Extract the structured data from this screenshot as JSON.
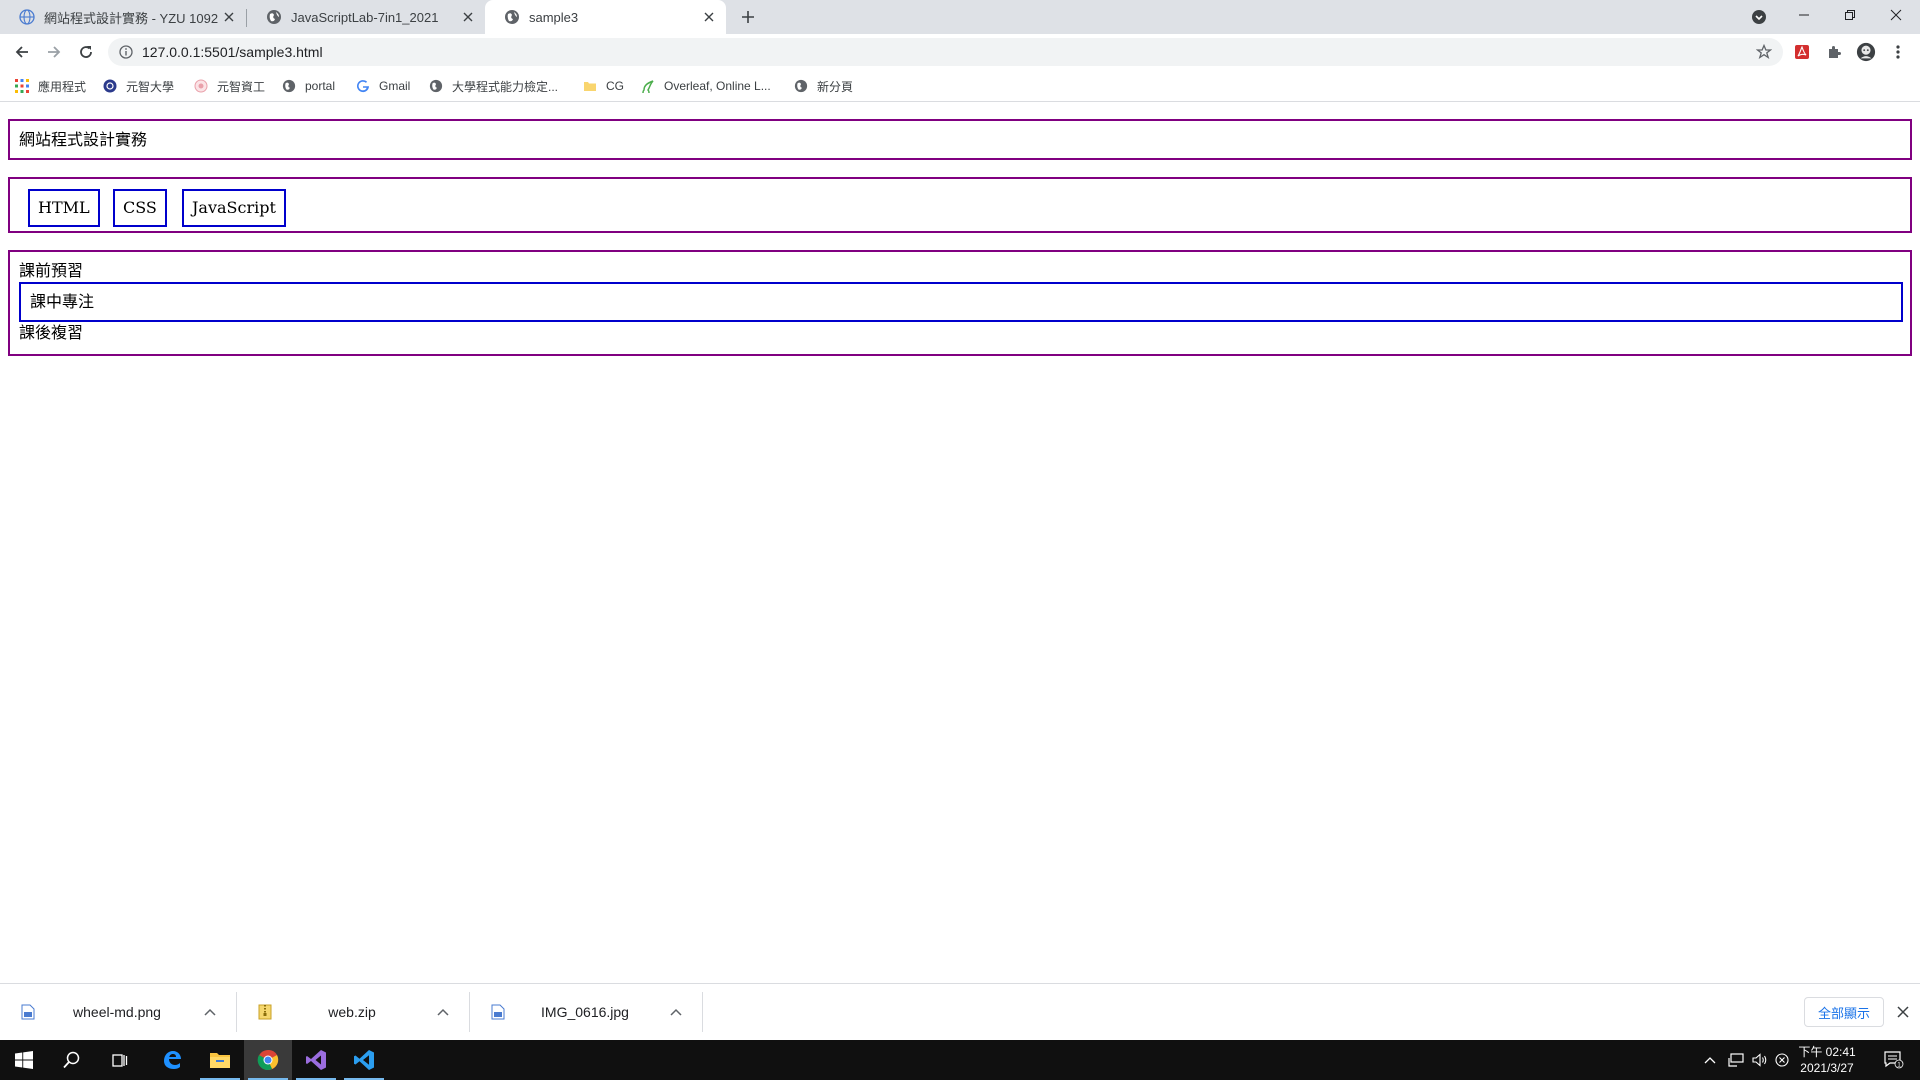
{
  "browser": {
    "tabs": [
      {
        "title": "網站程式設計實務 - YZU 1092",
        "icon": "globe-icon",
        "active": false
      },
      {
        "title": "JavaScriptLab-7in1_2021",
        "icon": "world-icon",
        "active": false
      },
      {
        "title": "sample3",
        "icon": "world-icon",
        "active": true
      }
    ],
    "url": "127.0.0.1:5501/sample3.html",
    "bookmarks": [
      {
        "label": "應用程式",
        "icon": "apps-grid-icon"
      },
      {
        "label": "元智大學",
        "icon": "yzu-logo-icon"
      },
      {
        "label": "元智資工",
        "icon": "yzu-cse-logo-icon"
      },
      {
        "label": "portal",
        "icon": "world-icon"
      },
      {
        "label": "Gmail",
        "icon": "google-g-icon"
      },
      {
        "label": "大學程式能力檢定...",
        "icon": "world-icon"
      },
      {
        "label": "CG",
        "icon": "folder-icon"
      },
      {
        "label": "Overleaf, Online L...",
        "icon": "overleaf-icon"
      },
      {
        "label": "新分頁",
        "icon": "world-icon"
      }
    ]
  },
  "page": {
    "header_text": "網站程式設計實務",
    "nav_items": [
      "HTML",
      "CSS",
      "JavaScript"
    ],
    "list_items": [
      "課前預習",
      "課中專注",
      "課後複習"
    ]
  },
  "downloads": {
    "items": [
      {
        "name": "wheel-md.png",
        "icon": "image-file-icon"
      },
      {
        "name": "web.zip",
        "icon": "zip-file-icon"
      },
      {
        "name": "IMG_0616.jpg",
        "icon": "image-file-icon"
      }
    ],
    "show_all": "全部顯示"
  },
  "taskbar": {
    "time": "下午 02:41",
    "date": "2021/3/27",
    "notification_count": "1"
  },
  "colors": {
    "box_border": "#800080",
    "focus_border": "#0000cc",
    "tab_strip": "#dee1e6",
    "taskbar": "#101010"
  }
}
